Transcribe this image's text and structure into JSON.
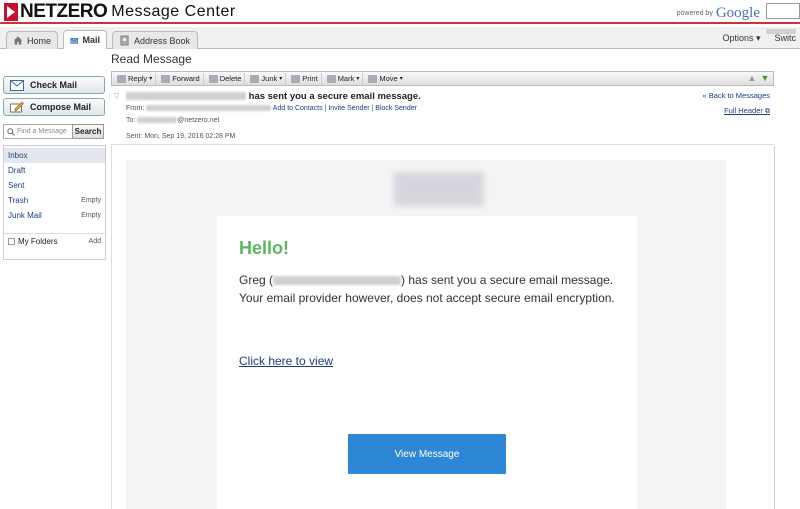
{
  "brand": {
    "name": "NETZERO",
    "product": "Message Center",
    "powered_by": "powered by",
    "google": "Google"
  },
  "tabs": [
    {
      "label": "Home"
    },
    {
      "label": "Mail"
    },
    {
      "label": "Address Book"
    }
  ],
  "topright": {
    "options": "Options ▾",
    "switch": "Switc"
  },
  "sidebar": {
    "check_mail": "Check Mail",
    "compose_mail": "Compose Mail",
    "find_placeholder": "Find a Message",
    "search_btn": "Search",
    "folders": [
      {
        "label": "Inbox",
        "action": ""
      },
      {
        "label": "Draft",
        "action": ""
      },
      {
        "label": "Sent",
        "action": ""
      },
      {
        "label": "Trash",
        "action": "Empty"
      },
      {
        "label": "Junk Mail",
        "action": "Empty"
      }
    ],
    "my_folders": "My Folders",
    "add": "Add"
  },
  "page_title": "Read Message",
  "toolbar": {
    "reply": "Reply",
    "forward": "Forward",
    "delete": "Delete",
    "junk": "Junk",
    "print": "Print",
    "mark": "Mark",
    "move": "Move"
  },
  "header": {
    "subject_suffix": "has sent you a secure email message.",
    "from_label": "From:",
    "add_contacts": "Add to Contacts",
    "invite_sender": "Invite Sender",
    "block_sender": "Block Sender",
    "to_label": "To:",
    "to_domain": "@netzero.net",
    "sent_label": "Sent:",
    "sent_value": "Mon, Sep 19, 2016 02:28 PM",
    "back": "« Back to Messages",
    "full_header": "Full Header"
  },
  "email": {
    "hello": "Hello!",
    "msg_prefix": "Greg (",
    "msg_suffix": ") has sent you a secure email message. Your email provider however, does not accept secure email encryption.",
    "click_here": "Click here to view",
    "view_btn": "View Message"
  }
}
